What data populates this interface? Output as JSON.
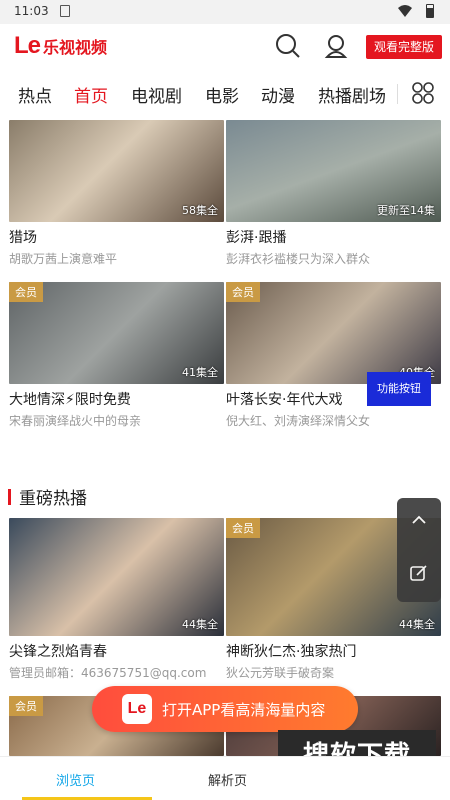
{
  "status": {
    "time": "11:03"
  },
  "header": {
    "brand": "乐视视频",
    "logo_text": "Le",
    "watch_full": "观看完整版"
  },
  "tabs": [
    {
      "label": "热点",
      "active": false
    },
    {
      "label": "首页",
      "active": true
    },
    {
      "label": "电视剧",
      "active": false
    },
    {
      "label": "电影",
      "active": false
    },
    {
      "label": "动漫",
      "active": false
    },
    {
      "label": "热播剧场",
      "active": false
    }
  ],
  "cards_top": [
    {
      "title": "猎场",
      "sub": "胡歌万茜上演意难平",
      "eps": "58集全",
      "vip": ""
    },
    {
      "title": "彭湃·跟播",
      "sub": "彭湃衣衫褴楼只为深入群众",
      "eps": "更新至14集",
      "vip": ""
    },
    {
      "title": "大地情深⚡限时免费",
      "sub": "宋春丽演绎战火中的母亲",
      "eps": "41集全",
      "vip": "会员"
    },
    {
      "title": "叶落长安·年代大戏",
      "sub": "倪大红、刘涛演绎深情父女",
      "eps": "40集全",
      "vip": "会员"
    }
  ],
  "section": {
    "title": "重磅热播"
  },
  "cards_hot": [
    {
      "title": "尖锋之烈焰青春",
      "sub": "管理员邮箱：463675751@qq.com",
      "eps": "44集全",
      "vip": ""
    },
    {
      "title": "神断狄仁杰·独家热门",
      "sub": "狄公元芳联手破奇案",
      "eps": "44集全",
      "vip": "会员"
    },
    {
      "vip": "会员"
    }
  ],
  "feature_button": "功能按钮",
  "open_app": {
    "logo_text": "Le",
    "label": "打开APP看高清海量内容"
  },
  "watermark": "搜软下载",
  "bottom_nav": {
    "browse": "浏览页",
    "parse": "解析页"
  },
  "colors": {
    "accent": "#e4161f",
    "vip": "#c99a44",
    "nav_active": "#12a6e8"
  }
}
